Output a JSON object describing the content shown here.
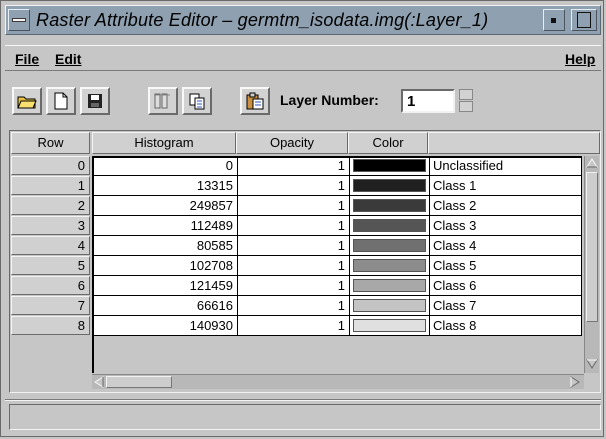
{
  "window": {
    "title": "Raster Attribute Editor – germtm_isodata.img(:Layer_1)"
  },
  "menu": {
    "file": "File",
    "edit": "Edit",
    "help": "Help"
  },
  "toolbar": {
    "layer_number_label": "Layer Number:",
    "layer_number_value": "1",
    "icons": [
      "open-folder-icon",
      "new-document-icon",
      "save-disk-icon",
      "column-properties-icon",
      "copy-icon",
      "paste-icon"
    ]
  },
  "table": {
    "columns": [
      "Row",
      "Histogram",
      "Opacity",
      "Color",
      ""
    ],
    "rows": [
      {
        "row": "0",
        "histogram": "0",
        "opacity": "1",
        "color": "#000000",
        "class_name": "Unclassified"
      },
      {
        "row": "1",
        "histogram": "13315",
        "opacity": "1",
        "color": "#202020",
        "class_name": "Class 1"
      },
      {
        "row": "2",
        "histogram": "249857",
        "opacity": "1",
        "color": "#3a3a3a",
        "class_name": "Class 2"
      },
      {
        "row": "3",
        "histogram": "112489",
        "opacity": "1",
        "color": "#555555",
        "class_name": "Class 3"
      },
      {
        "row": "4",
        "histogram": "80585",
        "opacity": "1",
        "color": "#707070",
        "class_name": "Class 4"
      },
      {
        "row": "5",
        "histogram": "102708",
        "opacity": "1",
        "color": "#8c8c8c",
        "class_name": "Class 5"
      },
      {
        "row": "6",
        "histogram": "121459",
        "opacity": "1",
        "color": "#a8a8a8",
        "class_name": "Class 6"
      },
      {
        "row": "7",
        "histogram": "66616",
        "opacity": "1",
        "color": "#c4c4c4",
        "class_name": "Class 7"
      },
      {
        "row": "8",
        "histogram": "140930",
        "opacity": "1",
        "color": "#e0e0e0",
        "class_name": "Class 8"
      }
    ]
  }
}
